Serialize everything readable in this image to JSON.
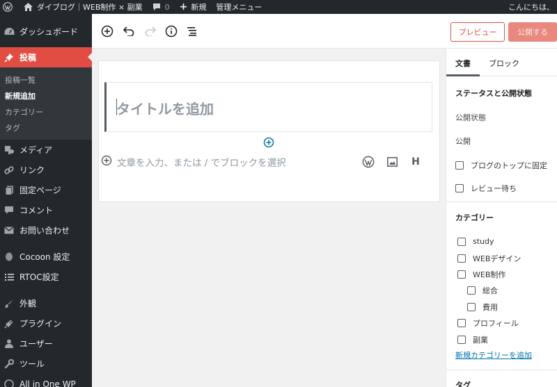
{
  "adminbar": {
    "site_name": "ダイブログ｜WEB制作 × 副業",
    "comment_count": "0",
    "new_label": "新規",
    "admin_menu_label": "管理メニュー",
    "greeting": "こんにちは、"
  },
  "sidebar": {
    "dashboard": "ダッシュボード",
    "posts": "投稿",
    "posts_submenu": [
      "投稿一覧",
      "新規追加",
      "カテゴリー",
      "タグ"
    ],
    "media": "メディア",
    "links": "リンク",
    "pages": "固定ページ",
    "comments": "コメント",
    "contact": "お問い合わせ",
    "cocoon": "Cocoon 設定",
    "rtoc": "RTOC設定",
    "appearance": "外観",
    "plugins": "プラグイン",
    "users": "ユーザー",
    "tools": "ツール",
    "aioseo": "All in One WP"
  },
  "toolbar": {
    "preview_label": "プレビュー",
    "publish_label": "公開する"
  },
  "editor": {
    "title_placeholder": "タイトルを追加",
    "body_placeholder": "文章を入力、または / でブロックを選択"
  },
  "settings": {
    "tab_document": "文書",
    "tab_block": "ブロック",
    "status_panel_title": "ステータスと公開状態",
    "visibility_label": "公開状態",
    "publish_label": "公開",
    "sticky_label": "ブログのトップに固定",
    "pending_label": "レビュー待ち",
    "categories_title": "カテゴリー",
    "categories": [
      "study",
      "WEBデザイン",
      "WEB制作",
      "総合",
      "費用",
      "プロフィール",
      "副業"
    ],
    "add_category_link": "新規カテゴリーを追加",
    "tags_title": "タグ"
  },
  "colors": {
    "admin_dark": "#23282d",
    "accent": "#e14d43",
    "link": "#0073aa"
  }
}
